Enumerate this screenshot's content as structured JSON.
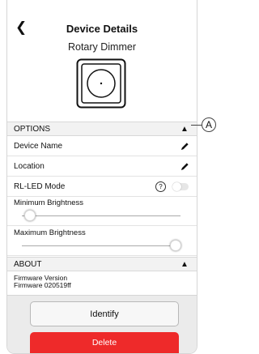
{
  "header": {
    "title": "Device Details",
    "subtitle": "Rotary Dimmer"
  },
  "options": {
    "section_title": "OPTIONS",
    "device_name_label": "Device Name",
    "location_label": "Location",
    "rl_led_label": "RL-LED Mode",
    "rl_led_help": "?",
    "rl_led_enabled": false,
    "min_brightness_label": "Minimum Brightness",
    "min_brightness_value": 0.05,
    "max_brightness_label": "Maximum Brightness",
    "max_brightness_value": 0.97
  },
  "about": {
    "section_title": "ABOUT",
    "firmware_label": "Firmware Version",
    "firmware_value": "Firmware 020519ff"
  },
  "actions": {
    "identify_label": "Identify",
    "delete_label": "Delete"
  },
  "annotation": {
    "callout_letter": "A"
  },
  "colors": {
    "delete": "#ee2a2a",
    "section_bg": "#f2f2f2",
    "footer_bg": "#ebebeb"
  }
}
